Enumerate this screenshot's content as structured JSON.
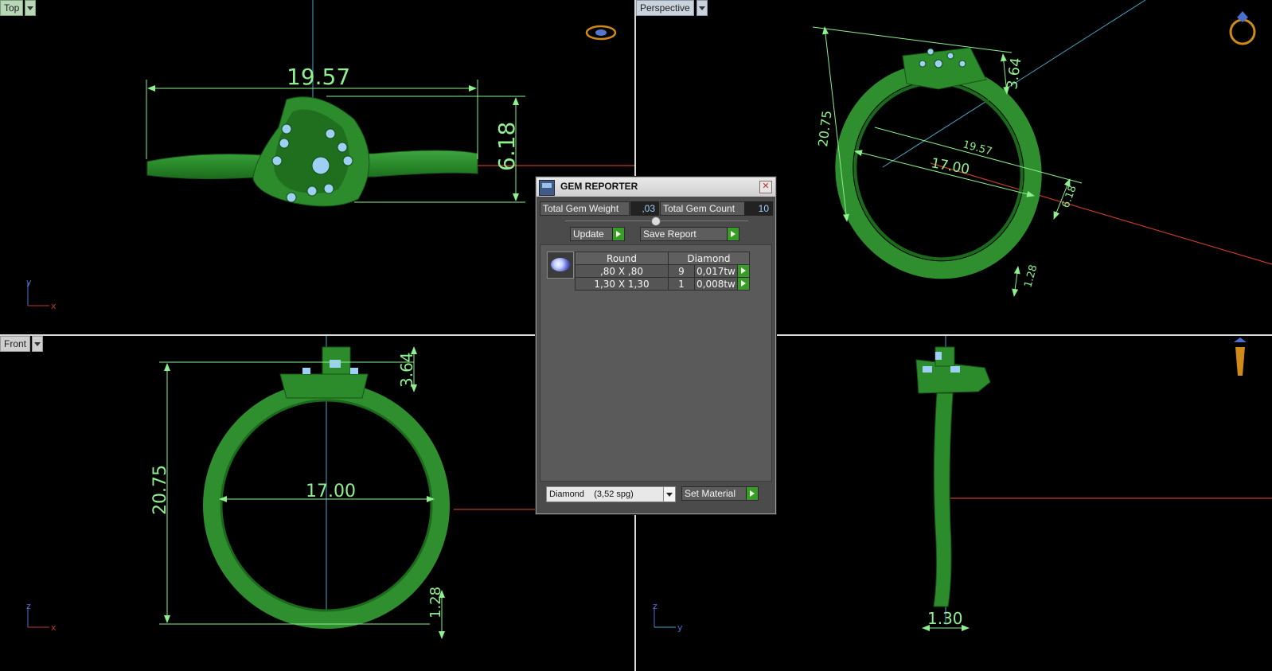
{
  "viewports": {
    "top": {
      "label": "Top"
    },
    "perspective": {
      "label": "Perspective"
    },
    "front": {
      "label": "Front"
    },
    "right": {
      "label": ""
    }
  },
  "dimensions": {
    "top_width": "19.57",
    "top_height": "6.18",
    "persp_height": "20.75",
    "persp_top": "3.64",
    "persp_width": "19.57",
    "persp_inner": "17.00",
    "persp_depth": "6.18",
    "persp_band": "1.28",
    "front_height": "20.75",
    "front_top": "3.64",
    "front_inner": "17.00",
    "front_band": "1.28",
    "side_width": "1.30"
  },
  "axes": {
    "top": {
      "v": "y",
      "h": "x"
    },
    "front": {
      "v": "z",
      "h": "x"
    },
    "right": {
      "v": "z",
      "h": "y"
    }
  },
  "gem_reporter": {
    "title": "GEM REPORTER",
    "total_weight_label": "Total Gem Weight",
    "total_weight_value": ",03",
    "total_count_label": "Total Gem Count",
    "total_count_value": "10",
    "update_label": "Update",
    "save_report_label": "Save Report",
    "table": {
      "col_shape": "Round",
      "col_type": "Diamond",
      "rows": [
        {
          "size": ",80 X ,80",
          "count": "9",
          "weight": "0,017tw"
        },
        {
          "size": "1,30 X 1,30",
          "count": "1",
          "weight": "0,008tw"
        }
      ]
    },
    "material_select": "Diamond    (3,52 spg)",
    "set_material_label": "Set Material"
  },
  "colors": {
    "dimension": "#8ef08e",
    "ring": "#2b8a2b",
    "gem": "#9ecff5",
    "axis_x": "#c0392b",
    "axis_y": "#4aa3c4"
  }
}
